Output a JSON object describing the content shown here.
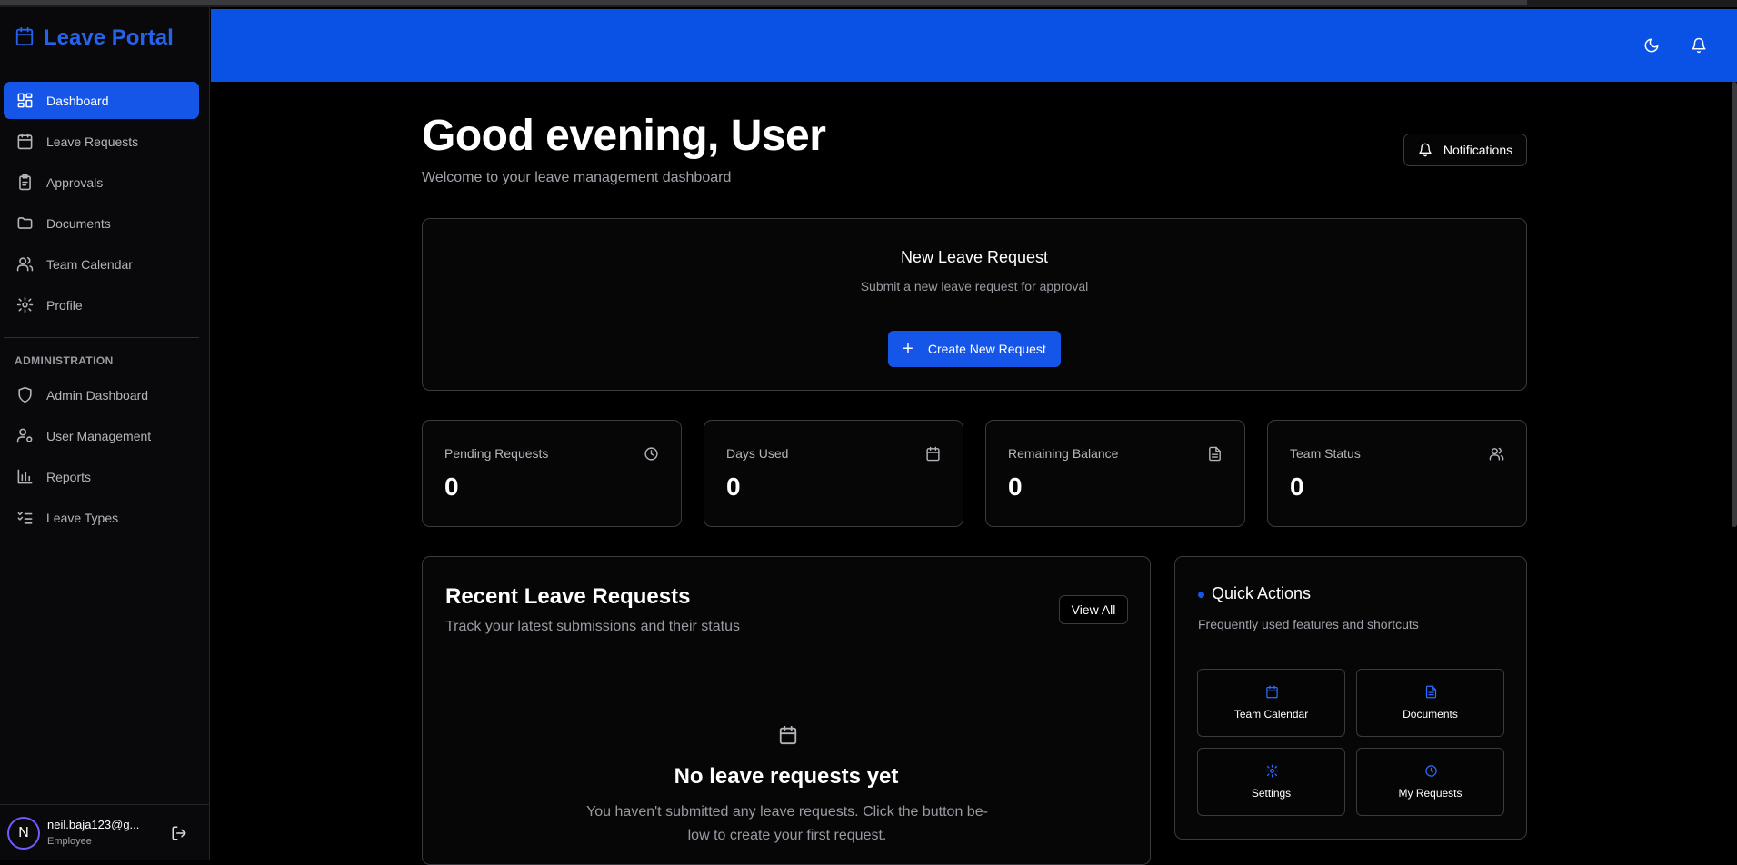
{
  "app": {
    "title": "Leave Portal"
  },
  "sidebar": {
    "items": [
      {
        "label": "Dashboard"
      },
      {
        "label": "Leave Requests"
      },
      {
        "label": "Approvals"
      },
      {
        "label": "Documents"
      },
      {
        "label": "Team Calendar"
      },
      {
        "label": "Profile"
      }
    ],
    "admin_section_label": "ADMINISTRATION",
    "admin_items": [
      {
        "label": "Admin Dashboard"
      },
      {
        "label": "User Management"
      },
      {
        "label": "Reports"
      },
      {
        "label": "Leave Types"
      }
    ],
    "user": {
      "initial": "N",
      "email": "neil.baja123@g...",
      "role": "Employee"
    }
  },
  "header": {
    "theme_icon": "moon-icon",
    "bell_icon": "bell-icon"
  },
  "main": {
    "greeting": "Good evening, User",
    "subtitle": "Welcome to your leave management dashboard",
    "notifications_label": "Notifications",
    "new_request": {
      "title": "New Leave Request",
      "subtitle": "Submit a new leave request for approval",
      "button_label": "Create New Request"
    },
    "stats": [
      {
        "label": "Pending Requests",
        "value": "0",
        "icon": "clock-icon"
      },
      {
        "label": "Days Used",
        "value": "0",
        "icon": "calendar-icon"
      },
      {
        "label": "Remaining Balance",
        "value": "0",
        "icon": "document-icon"
      },
      {
        "label": "Team Status",
        "value": "0",
        "icon": "users-icon"
      }
    ],
    "recent": {
      "title": "Recent Leave Requests",
      "subtitle": "Track your latest submissions and their status",
      "view_all_label": "View All",
      "empty_title": "No leave requests yet",
      "empty_text": "You haven't submitted any leave requests. Click the button be- low to create your first request."
    },
    "quick_actions": {
      "title": "Quick Actions",
      "subtitle": "Frequently used features and shortcuts",
      "items": [
        {
          "label": "Team Calendar",
          "icon": "calendar-icon"
        },
        {
          "label": "Documents",
          "icon": "document-icon"
        },
        {
          "label": "Settings",
          "icon": "gear-icon"
        },
        {
          "label": "My Requests",
          "icon": "clock-icon"
        }
      ]
    }
  },
  "colors": {
    "accent": "#1556e8",
    "header": "#0a52e6",
    "background": "#000000"
  }
}
